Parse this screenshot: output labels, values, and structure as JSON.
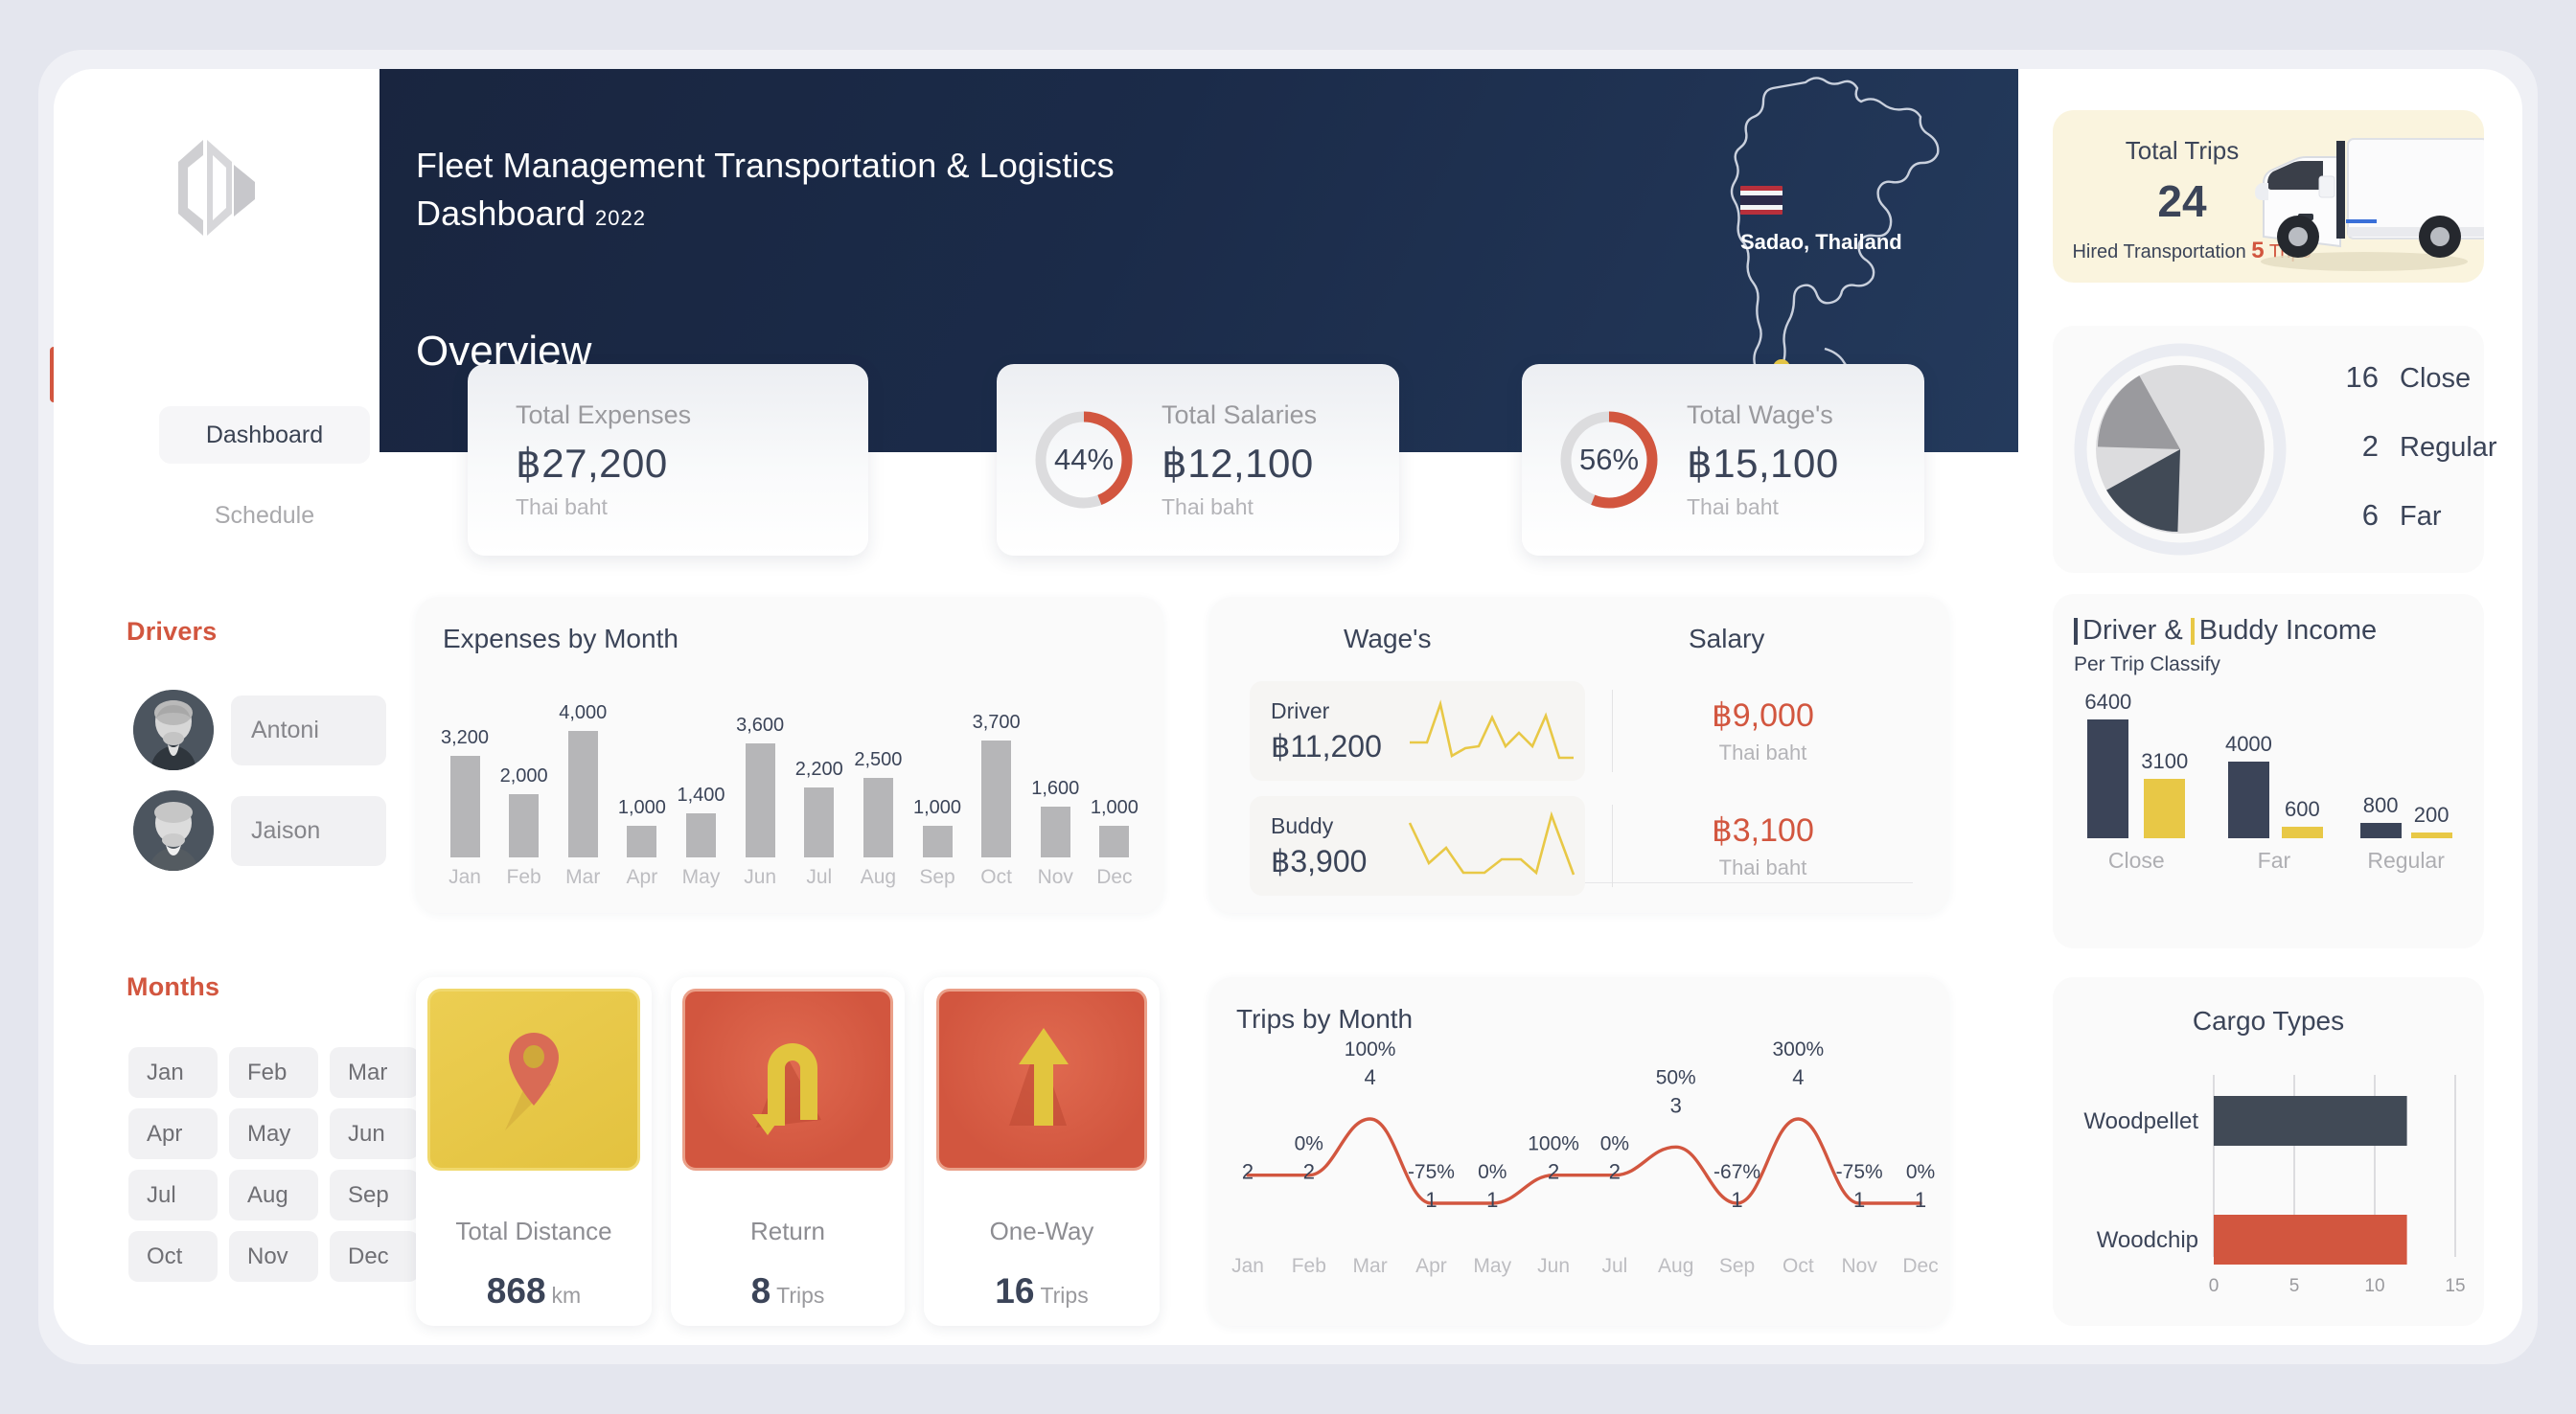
{
  "brand": {
    "logo_name": "DL"
  },
  "sidebar": {
    "nav": [
      {
        "label": "Dashboard",
        "active": true
      },
      {
        "label": "Schedule",
        "active": false
      }
    ],
    "drivers_title": "Drivers",
    "drivers": [
      {
        "name": "Antoni"
      },
      {
        "name": "Jaison"
      }
    ],
    "months_title": "Months",
    "months": [
      "Jan",
      "Feb",
      "Mar",
      "Apr",
      "May",
      "Jun",
      "Jul",
      "Aug",
      "Sep",
      "Oct",
      "Nov",
      "Dec"
    ]
  },
  "header": {
    "title_line1": "Fleet Management Transportation & Logistics",
    "title_line2": "Dashboard",
    "year": "2022",
    "section": "Overview",
    "location": "Sadao, Thailand"
  },
  "kpis": [
    {
      "label": "Total Expenses",
      "value": "฿27,200",
      "unit": "Thai baht",
      "percent": null
    },
    {
      "label": "Total Salaries",
      "value": "฿12,100",
      "unit": "Thai baht",
      "percent": "44%",
      "percent_num": 44
    },
    {
      "label": "Total Wage's",
      "value": "฿15,100",
      "unit": "Thai baht",
      "percent": "56%",
      "percent_num": 56
    }
  ],
  "expenses_panel": {
    "title": "Expenses by Month"
  },
  "wages_panel": {
    "wages_header": "Wage's",
    "salary_header": "Salary",
    "rows": [
      {
        "role": "Driver",
        "wage": "฿11,200",
        "salary": "฿9,000",
        "salary_unit": "Thai baht"
      },
      {
        "role": "Buddy",
        "wage": "฿3,900",
        "salary": "฿3,100",
        "salary_unit": "Thai baht"
      }
    ]
  },
  "tiles": [
    {
      "icon": "location-pin-icon",
      "label": "Total Distance",
      "number": "868",
      "unit": "km"
    },
    {
      "icon": "u-turn-arrow-icon",
      "label": "Return",
      "number": "8",
      "unit": "Trips"
    },
    {
      "icon": "up-arrow-icon",
      "label": "One-Way",
      "number": "16",
      "unit": "Trips"
    }
  ],
  "trips_panel": {
    "title": "Trips by Month"
  },
  "right": {
    "total_trips": {
      "label": "Total Trips",
      "value": "24",
      "sub_label": "Hired Transportation",
      "sub_value": "5",
      "sub_unit": "Trips"
    },
    "pie_legend": [
      {
        "value": "16",
        "label": "Close"
      },
      {
        "value": "2",
        "label": "Regular"
      },
      {
        "value": "6",
        "label": "Far"
      }
    ],
    "income": {
      "title_driver": "Driver &",
      "title_buddy": "Buddy Income",
      "subtitle": "Per Trip Classify"
    },
    "cargo": {
      "title": "Cargo Types"
    }
  },
  "colors": {
    "accent_red": "#d2563f",
    "navy": "#1b2b49",
    "yellow": "#e8c846",
    "slate": "#3b4458",
    "gray_bar": "#b6b6b8"
  },
  "chart_data": [
    {
      "type": "bar",
      "id": "expenses-by-month",
      "title": "Expenses by Month",
      "categories": [
        "Jan",
        "Feb",
        "Mar",
        "Apr",
        "May",
        "Jun",
        "Jul",
        "Aug",
        "Sep",
        "Oct",
        "Nov",
        "Dec"
      ],
      "values": [
        3200,
        2000,
        4000,
        1000,
        1400,
        3600,
        2200,
        2500,
        1000,
        3700,
        1600,
        1000
      ],
      "labels": [
        "3,200",
        "2,000",
        "4,000",
        "1,000",
        "1,400",
        "3,600",
        "2,200",
        "2,500",
        "1,000",
        "3,700",
        "1,600",
        "1,000"
      ],
      "xlabel": "",
      "ylabel": "",
      "ylim": [
        0,
        4000
      ],
      "grid": false,
      "legend": "none"
    },
    {
      "type": "line",
      "id": "trips-by-month",
      "title": "Trips by Month",
      "categories": [
        "Jan",
        "Feb",
        "Mar",
        "Apr",
        "May",
        "Jun",
        "Jul",
        "Aug",
        "Sep",
        "Oct",
        "Nov",
        "Dec"
      ],
      "values": [
        2,
        2,
        4,
        1,
        1,
        2,
        2,
        3,
        1,
        4,
        1,
        1
      ],
      "pct_labels": [
        "",
        "0%",
        "100%",
        "-75%",
        "0%",
        "100%",
        "0%",
        "50%",
        "-67%",
        "300%",
        "-75%",
        "0%"
      ],
      "ylim": [
        0,
        4
      ],
      "grid": false,
      "legend": "none",
      "line_color": "#d2563f"
    },
    {
      "type": "pie",
      "id": "trip-distance-classify",
      "categories": [
        "Close",
        "Regular",
        "Far"
      ],
      "values": [
        16,
        2,
        6
      ],
      "colors": [
        "#dcdcde",
        "#9a9a9e",
        "#414a56"
      ],
      "legend": "right"
    },
    {
      "type": "bar",
      "id": "driver-buddy-income",
      "title": "Driver & Buddy Income",
      "subtitle": "Per Trip Classify",
      "categories": [
        "Close",
        "Far",
        "Regular"
      ],
      "series": [
        {
          "name": "Driver",
          "values": [
            6400,
            4000,
            800
          ],
          "color": "#3b4458"
        },
        {
          "name": "Buddy",
          "values": [
            3100,
            600,
            200
          ],
          "color": "#e8c846"
        }
      ],
      "ylim": [
        0,
        6400
      ],
      "grid": false,
      "legend": "top"
    },
    {
      "type": "bar",
      "id": "cargo-types",
      "title": "Cargo Types",
      "orientation": "horizontal",
      "categories": [
        "Woodpellet",
        "Woodchip"
      ],
      "values": [
        12,
        12
      ],
      "colors": [
        "#414a56",
        "#d2563f"
      ],
      "xticks": [
        "0",
        "5",
        "10",
        "15"
      ],
      "xlim": [
        0,
        15
      ],
      "grid": true,
      "legend": "none"
    },
    {
      "type": "line",
      "id": "driver-wage-sparkline",
      "values": [
        2.0,
        2.0,
        6.2,
        1.2,
        2.3,
        2.0,
        5.0,
        2.3,
        3.8,
        2.5,
        5.2,
        1.1,
        1.1
      ],
      "color": "#e8c846",
      "grid": false,
      "legend": "none"
    },
    {
      "type": "line",
      "id": "buddy-wage-sparkline",
      "values": [
        5.2,
        1.6,
        3.0,
        1.0,
        1.0,
        2.0,
        2.0,
        1.0,
        5.6,
        1.0
      ],
      "color": "#e8c846",
      "grid": false,
      "legend": "none"
    }
  ]
}
